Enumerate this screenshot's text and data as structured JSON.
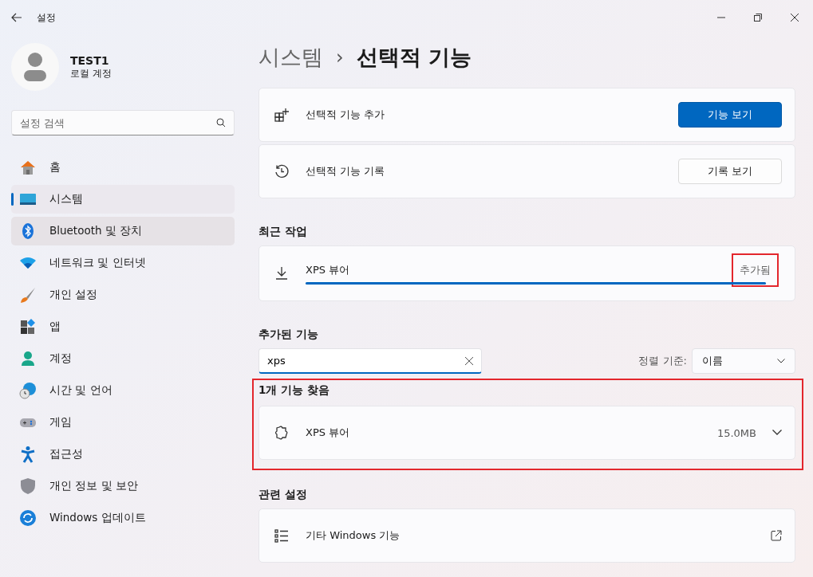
{
  "window": {
    "title": "설정"
  },
  "user": {
    "name": "TEST1",
    "account": "로컬 계정"
  },
  "search": {
    "placeholder": "설정 검색"
  },
  "sidebar": {
    "items": [
      {
        "label": "홈",
        "selected": false,
        "hovered": false
      },
      {
        "label": "시스템",
        "selected": true,
        "hovered": false
      },
      {
        "label": "Bluetooth 및 장치",
        "selected": false,
        "hovered": true
      },
      {
        "label": "네트워크 및 인터넷",
        "selected": false,
        "hovered": false
      },
      {
        "label": "개인 설정",
        "selected": false,
        "hovered": false
      },
      {
        "label": "앱",
        "selected": false,
        "hovered": false
      },
      {
        "label": "계정",
        "selected": false,
        "hovered": false
      },
      {
        "label": "시간 및 언어",
        "selected": false,
        "hovered": false
      },
      {
        "label": "게임",
        "selected": false,
        "hovered": false
      },
      {
        "label": "접근성",
        "selected": false,
        "hovered": false
      },
      {
        "label": "개인 정보 및 보안",
        "selected": false,
        "hovered": false
      },
      {
        "label": "Windows 업데이트",
        "selected": false,
        "hovered": false
      }
    ]
  },
  "breadcrumb": {
    "parent": "시스템",
    "separator": "›",
    "current": "선택적 기능"
  },
  "actions": [
    {
      "label": "선택적 기능 추가",
      "button": "기능 보기",
      "primary": true
    },
    {
      "label": "선택적 기능 기록",
      "button": "기록 보기",
      "primary": false
    }
  ],
  "recent": {
    "heading": "최근 작업",
    "item": {
      "name": "XPS 뷰어",
      "status": "추가됨",
      "level": 1,
      "highlighted": true
    }
  },
  "installed": {
    "heading": "추가된 기능",
    "filter": {
      "value": "xps"
    },
    "sort_label": "정렬 기준:",
    "sort_value": "이름",
    "result_count": "1개 기능 찾음",
    "highlighted": true,
    "features": [
      {
        "name": "XPS 뷰어",
        "size": "15.0MB",
        "expanded": false
      }
    ]
  },
  "related": {
    "heading": "관련 설정",
    "items": [
      {
        "label": "기타 Windows 기능"
      }
    ]
  }
}
